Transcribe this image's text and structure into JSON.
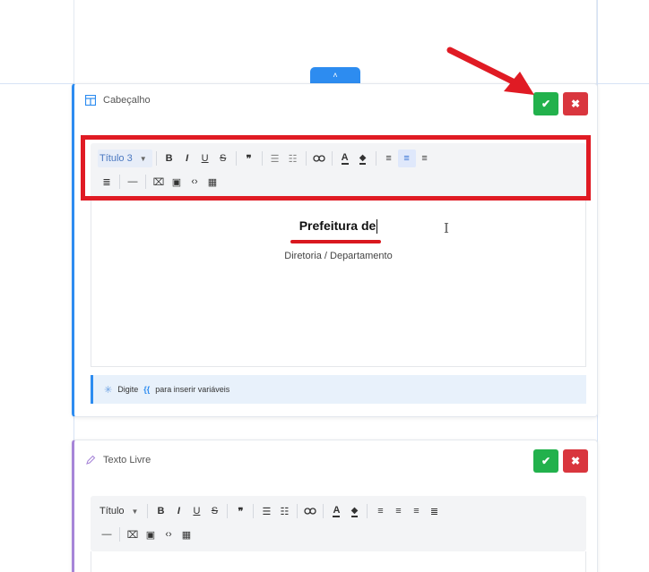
{
  "top_tab": {
    "icon": "chevron-up-icon",
    "glyph": "˄"
  },
  "header_card": {
    "title": "Cabeçalho",
    "icon": "layout-icon",
    "confirm_glyph": "✔",
    "cancel_glyph": "✖",
    "toolbar": {
      "heading_select": "Título 3",
      "row1": [
        "B",
        "I",
        "U",
        "S",
        "❞",
        "☰",
        "☷",
        "⊝",
        "A",
        "◈",
        "≡",
        "≡",
        "≡"
      ],
      "row2": [
        "≣",
        "—",
        "⌧",
        "▣",
        "‹›",
        "▦"
      ]
    },
    "content": {
      "title": "Prefeitura de",
      "subtitle": "Diretoria / Departamento"
    },
    "hint": {
      "prefix": "Digite",
      "braces": "{{",
      "suffix": "para inserir variáveis"
    }
  },
  "text_card": {
    "title": "Texto Livre",
    "icon": "pencil-icon",
    "confirm_glyph": "✔",
    "cancel_glyph": "✖",
    "toolbar": {
      "heading_select": "Título"
    }
  },
  "colors": {
    "accent": "#2d8cf0",
    "confirm": "#22b14c",
    "cancel": "#d9363e",
    "annotation": "#e01b24",
    "text_card_accent": "#a785d8"
  }
}
